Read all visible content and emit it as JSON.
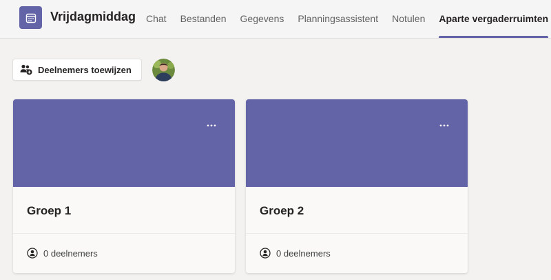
{
  "header": {
    "title": "Vrijdagmiddag",
    "app_icon": "calendar-icon",
    "tabs": [
      {
        "label": "Chat",
        "active": false
      },
      {
        "label": "Bestanden",
        "active": false
      },
      {
        "label": "Gegevens",
        "active": false
      },
      {
        "label": "Planningsassistent",
        "active": false
      },
      {
        "label": "Notulen",
        "active": false
      },
      {
        "label": "Aparte vergaderruimten",
        "active": true
      }
    ]
  },
  "toolbar": {
    "assign_label": "Deelnemers toewijzen",
    "assign_icon": "people-add-icon",
    "avatar": "user-avatar"
  },
  "rooms": [
    {
      "name": "Groep 1",
      "participants": "0 deelnemers",
      "more_icon": "more-horizontal-icon"
    },
    {
      "name": "Groep 2",
      "participants": "0 deelnemers",
      "more_icon": "more-horizontal-icon"
    }
  ],
  "colors": {
    "brand": "#6264a7",
    "background": "#f3f2f1",
    "card": "#faf9f8"
  }
}
